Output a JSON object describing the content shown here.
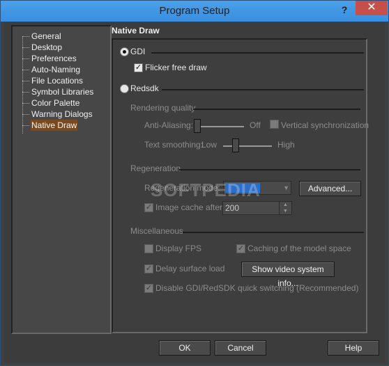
{
  "window": {
    "title": "Program Setup",
    "help_glyph": "?",
    "close_glyph": "✕"
  },
  "tree": {
    "items": [
      {
        "label": "General"
      },
      {
        "label": "Desktop"
      },
      {
        "label": "Preferences"
      },
      {
        "label": "Auto-Naming"
      },
      {
        "label": "File Locations"
      },
      {
        "label": "Symbol Libraries"
      },
      {
        "label": "Color Palette"
      },
      {
        "label": "Warning Dialogs"
      },
      {
        "label": "Native Draw"
      }
    ],
    "selected": "Native Draw"
  },
  "panel": {
    "title": "Native Draw",
    "gdi_label": "GDI",
    "flicker_label": "Flicker free draw",
    "redsdk_label": "Redsdk",
    "rendering_quality": "Rendering quality",
    "anti_aliasing": "Anti-Aliasing:",
    "anti_aliasing_value": "Off",
    "vertical_sync": "Vertical synchronization",
    "text_smoothing": "Text smoothing:",
    "text_low": "Low",
    "text_high": "High",
    "regeneration": "Regeneration",
    "regeneration_mode": "Regeneration mode:",
    "regeneration_mode_value": "",
    "advanced": "Advanced...",
    "image_cache": "Image cache after",
    "image_cache_value": "200",
    "miscellaneous": "Miscellaneous",
    "display_fps": "Display FPS",
    "caching_model": "Caching of the model space",
    "delay_surface": "Delay surface load",
    "show_video": "Show video system info...",
    "disable_switch": "Disable GDI/RedSDK quick switching (Recommended)"
  },
  "watermark": "SOFTPEDIA",
  "footer": {
    "ok": "OK",
    "cancel": "Cancel",
    "help": "Help"
  }
}
